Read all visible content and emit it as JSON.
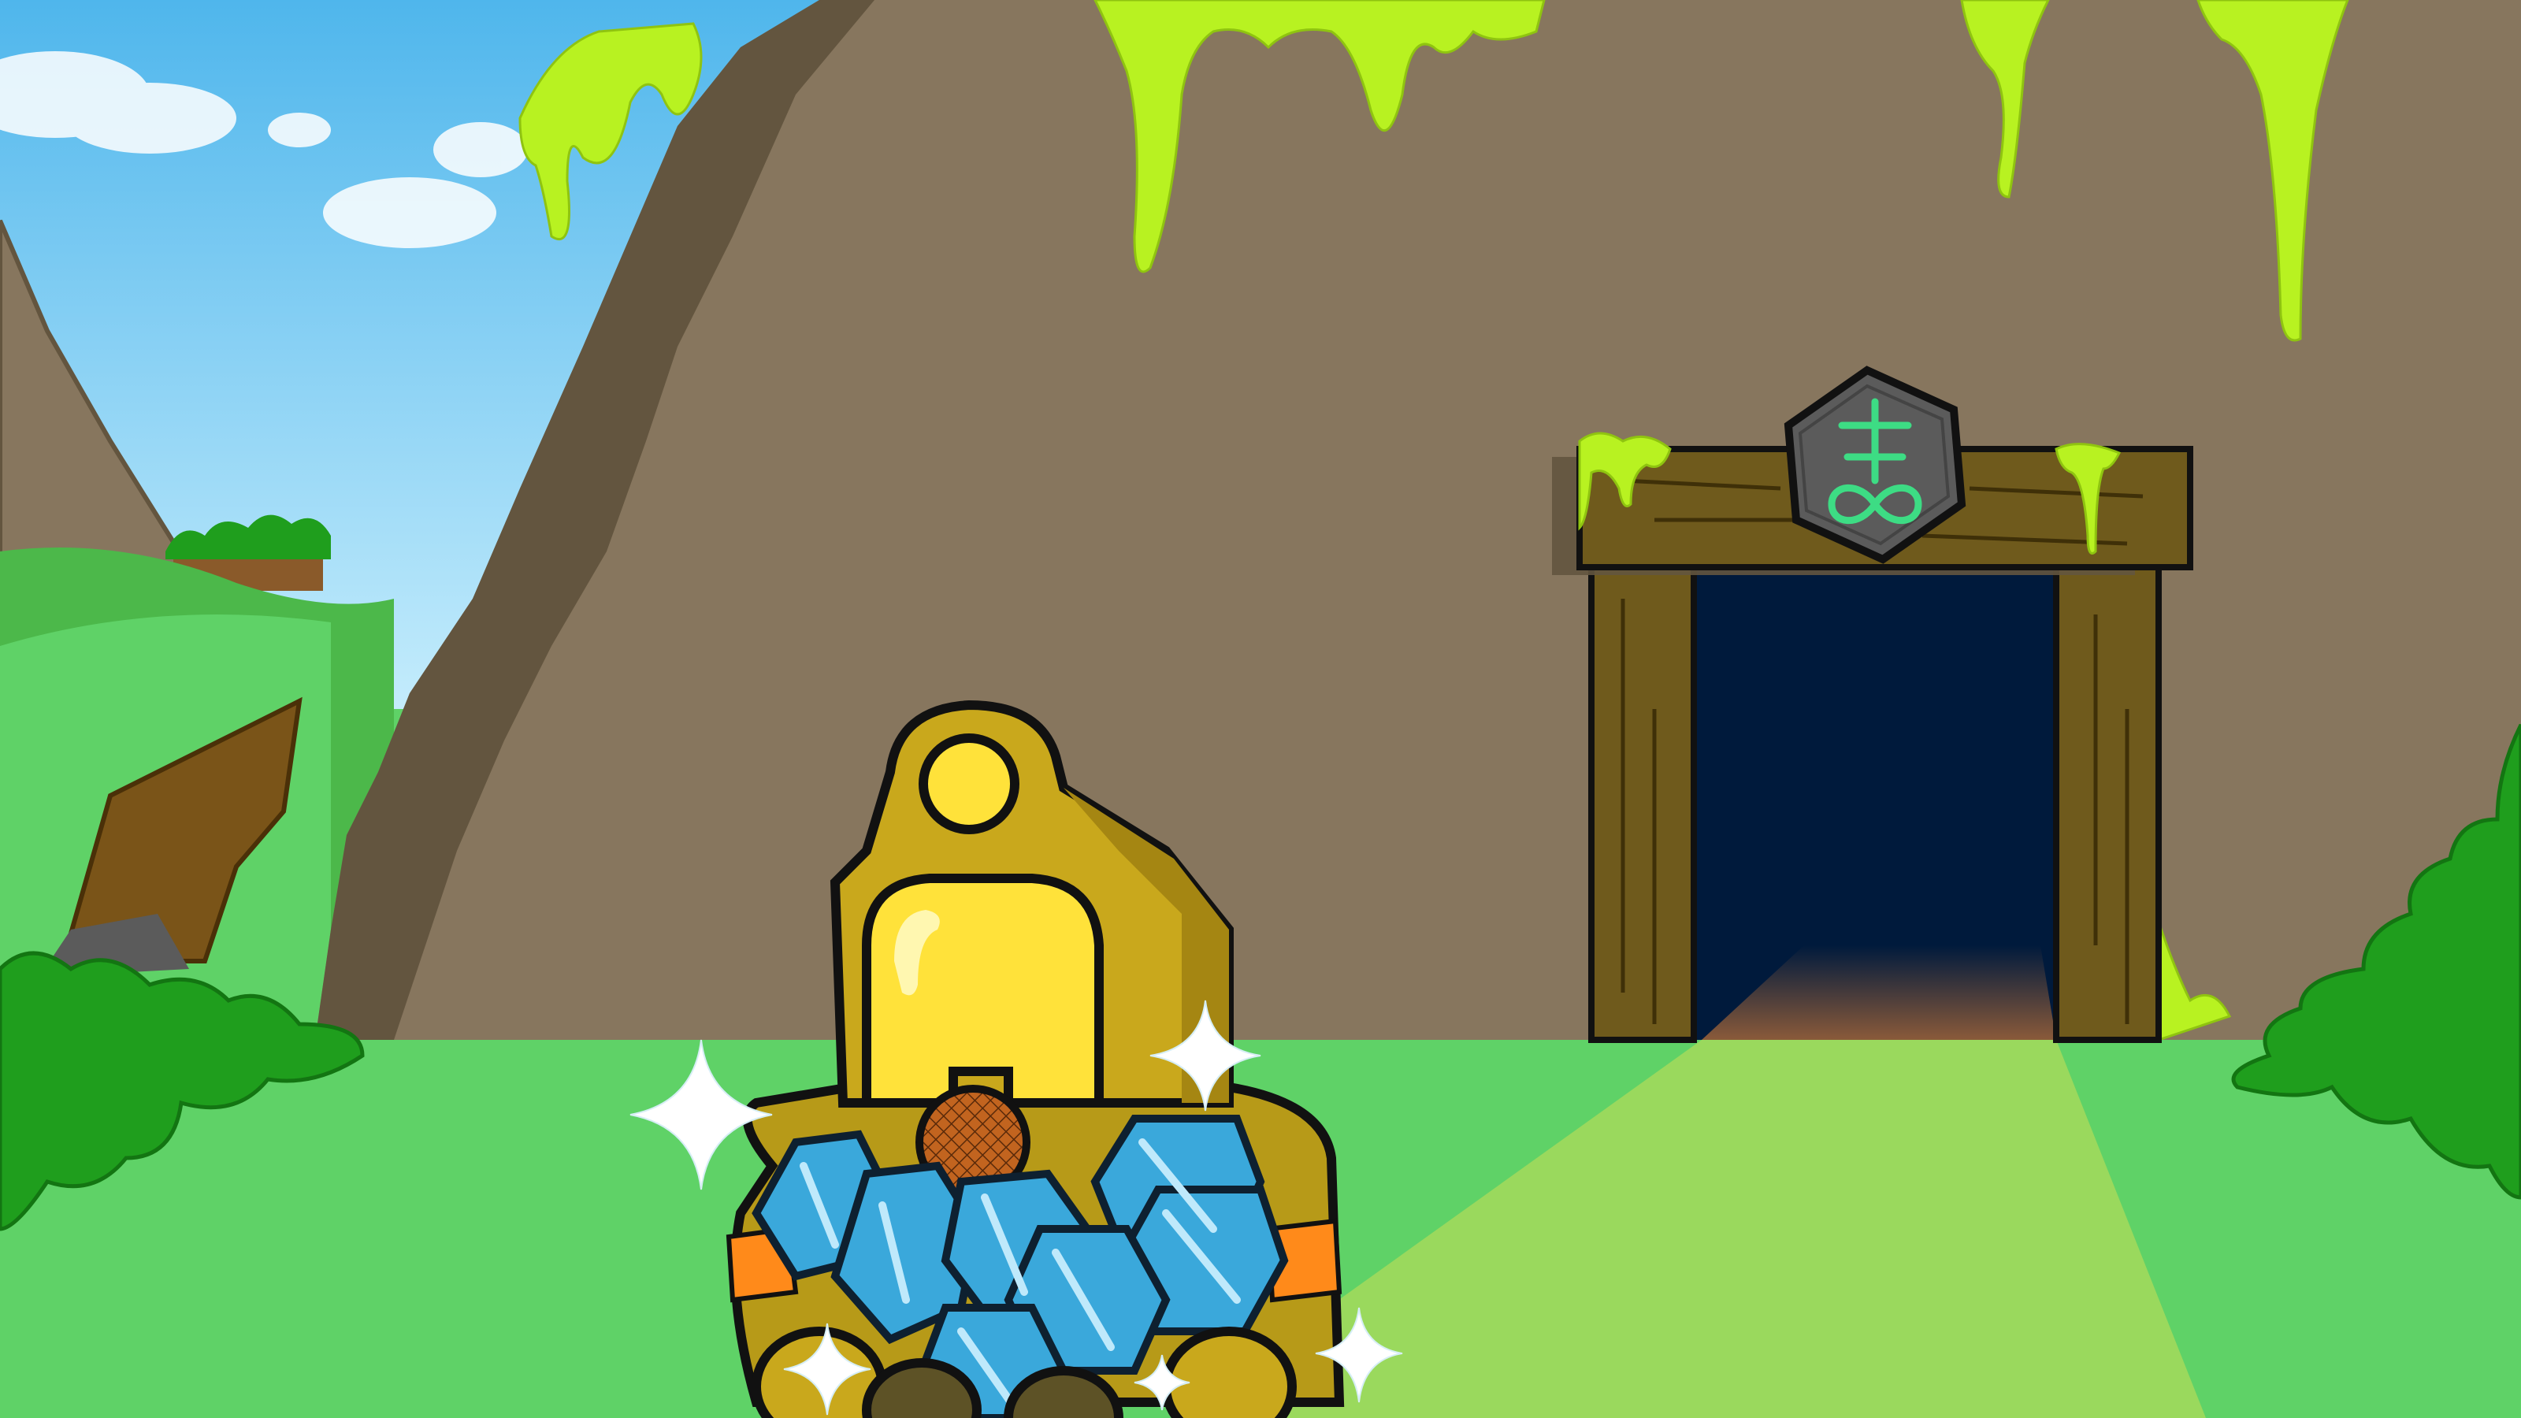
{
  "scene": {
    "type": "game-scene",
    "description_free": true,
    "elements": {
      "sky": "sky",
      "mountain": "mountain",
      "slime": "green-slime",
      "mine_entrance": "mine-entrance",
      "sign_symbol": "sulfur-alchemy-symbol",
      "character": "yellow-diving-suit-miner",
      "gems": "blue-gems",
      "sparkles": "sparkle"
    }
  },
  "colors": {
    "sky_top": "#5ec3f2",
    "sky_bottom": "#b9e6fb",
    "grass": "#5fd267",
    "grass_light": "#9ad95d",
    "mountain": "#87765e",
    "mountain_shadow": "#63553f",
    "slime": "#b8f221",
    "wood": "#6f5a1c",
    "wood_dark": "#4f3f10",
    "tunnel": "#001a3c",
    "sign_bg": "#5b5b5b",
    "sign_symbol": "#3ddc84",
    "suit_yellow": "#c9a81c",
    "visor": "#ffe23a",
    "orange_stripe": "#ff8a1a",
    "gem_blue": "#3aa8db",
    "bush": "#1f9e1d"
  }
}
